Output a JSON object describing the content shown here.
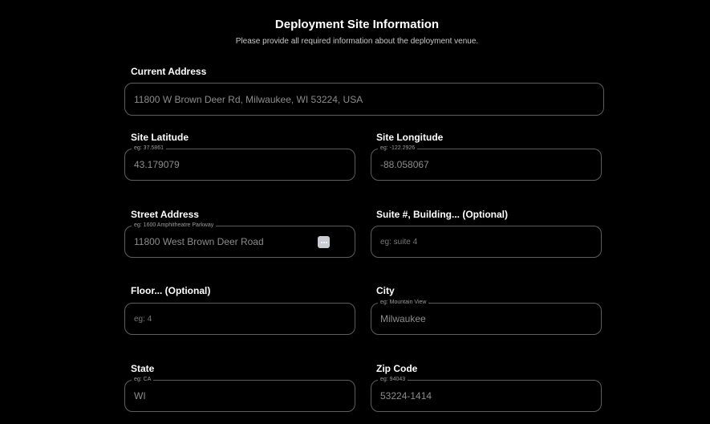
{
  "header": {
    "title": "Deployment Site Information",
    "subtitle": "Please provide all required information about the deployment venue."
  },
  "fields": {
    "current_address": {
      "label": "Current Address",
      "value": "11800 W Brown Deer Rd, Milwaukee, WI 53224, USA"
    },
    "site_latitude": {
      "label": "Site Latitude",
      "hint": "eg: 37.5861",
      "value": "43.179079"
    },
    "site_longitude": {
      "label": "Site Longitude",
      "hint": "eg: -122.2926",
      "value": "-88.058067"
    },
    "street_address": {
      "label": "Street Address",
      "hint": "eg: 1600 Amphitheatre Parkway",
      "value": "11800 West Brown Deer Road",
      "action_icon": "more-dots-icon"
    },
    "suite": {
      "label": "Suite #, Building... (Optional)",
      "placeholder": "eg: suite 4"
    },
    "floor": {
      "label": "Floor... (Optional)",
      "placeholder": "eg: 4"
    },
    "city": {
      "label": "City",
      "hint": "eg: Mountain View",
      "value": "Milwaukee"
    },
    "state": {
      "label": "State",
      "hint": "eg: CA",
      "value": "WI"
    },
    "zip_code": {
      "label": "Zip Code",
      "hint": "eg: 94043",
      "value": "53224-1414"
    }
  },
  "colors": {
    "background": "#000000",
    "border": "#5e5e5e",
    "value_text": "#8c8c8c"
  }
}
